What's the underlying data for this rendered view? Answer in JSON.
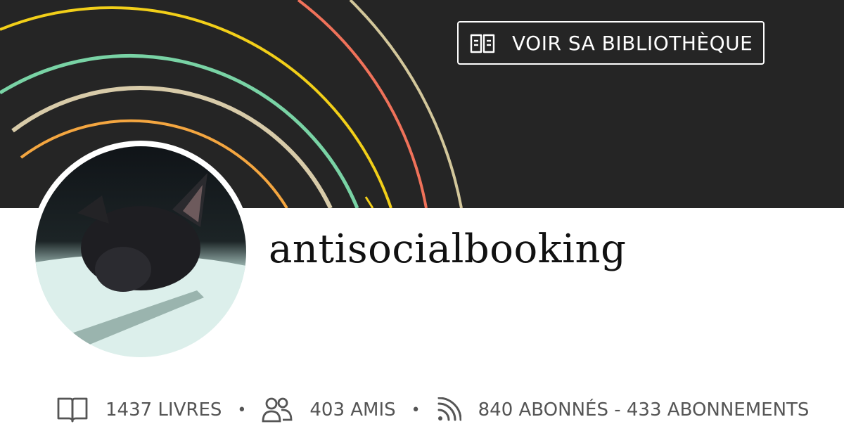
{
  "profile": {
    "username": "antisocialbooking",
    "avatar_icon": "cat-photo-avatar"
  },
  "header": {
    "library_button_label": "VOIR SA BIBLIOTHÈQUE",
    "library_icon": "open-book-icon",
    "background_color": "#252525",
    "arc_colors": [
      "#f4a640",
      "#d8cba9",
      "#79d3a5",
      "#f2cf19",
      "#f0725a",
      "#d3c79b"
    ]
  },
  "stats": {
    "books": {
      "icon": "book-icon",
      "label": "1437 LIVRES"
    },
    "separator": "•",
    "friends": {
      "icon": "users-icon",
      "label": "403 AMIS"
    },
    "followers": {
      "icon": "rss-icon",
      "label": "840 ABONNÉS - 433 ABONNEMENTS"
    }
  }
}
